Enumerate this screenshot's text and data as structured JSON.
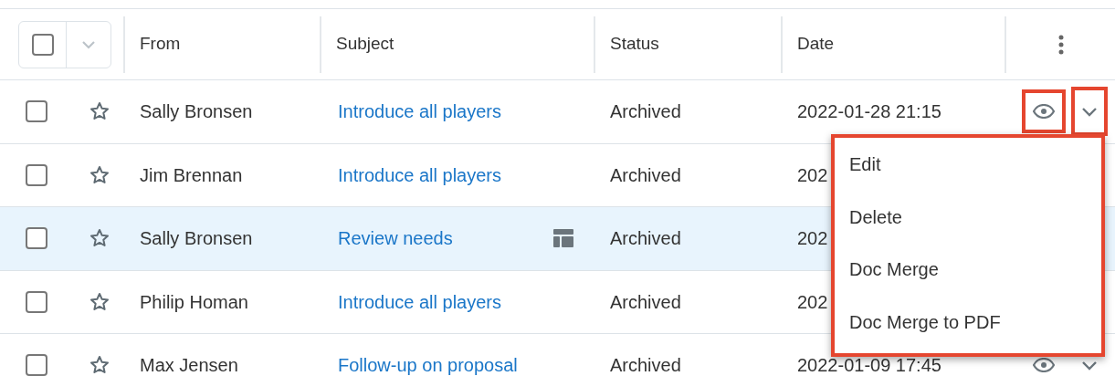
{
  "table": {
    "columns": [
      "From",
      "Subject",
      "Status",
      "Date"
    ],
    "header": {
      "select_all_checked": false
    },
    "rows": [
      {
        "checked": false,
        "starred": false,
        "selected": false,
        "from": "Sally Bronsen",
        "subject": "Introduce all players",
        "preview_icon": false,
        "status": "Archived",
        "date": "2022-01-28 21:15"
      },
      {
        "checked": false,
        "starred": false,
        "selected": false,
        "from": "Jim Brennan",
        "subject": "Introduce all players",
        "preview_icon": false,
        "status": "Archived",
        "date": "202"
      },
      {
        "checked": false,
        "starred": false,
        "selected": true,
        "from": "Sally Bronsen",
        "subject": "Review needs",
        "preview_icon": true,
        "status": "Archived",
        "date": "202"
      },
      {
        "checked": false,
        "starred": false,
        "selected": false,
        "from": "Philip Homan",
        "subject": "Introduce all players",
        "preview_icon": false,
        "status": "Archived",
        "date": "202"
      },
      {
        "checked": false,
        "starred": false,
        "selected": false,
        "from": "Max Jensen",
        "subject": "Follow-up on proposal",
        "preview_icon": false,
        "status": "Archived",
        "date": "2022-01-09 17:45"
      }
    ]
  },
  "action_menu": {
    "highlighted": true,
    "items": [
      "Edit",
      "Delete",
      "Doc Merge",
      "Doc Merge to PDF"
    ]
  }
}
